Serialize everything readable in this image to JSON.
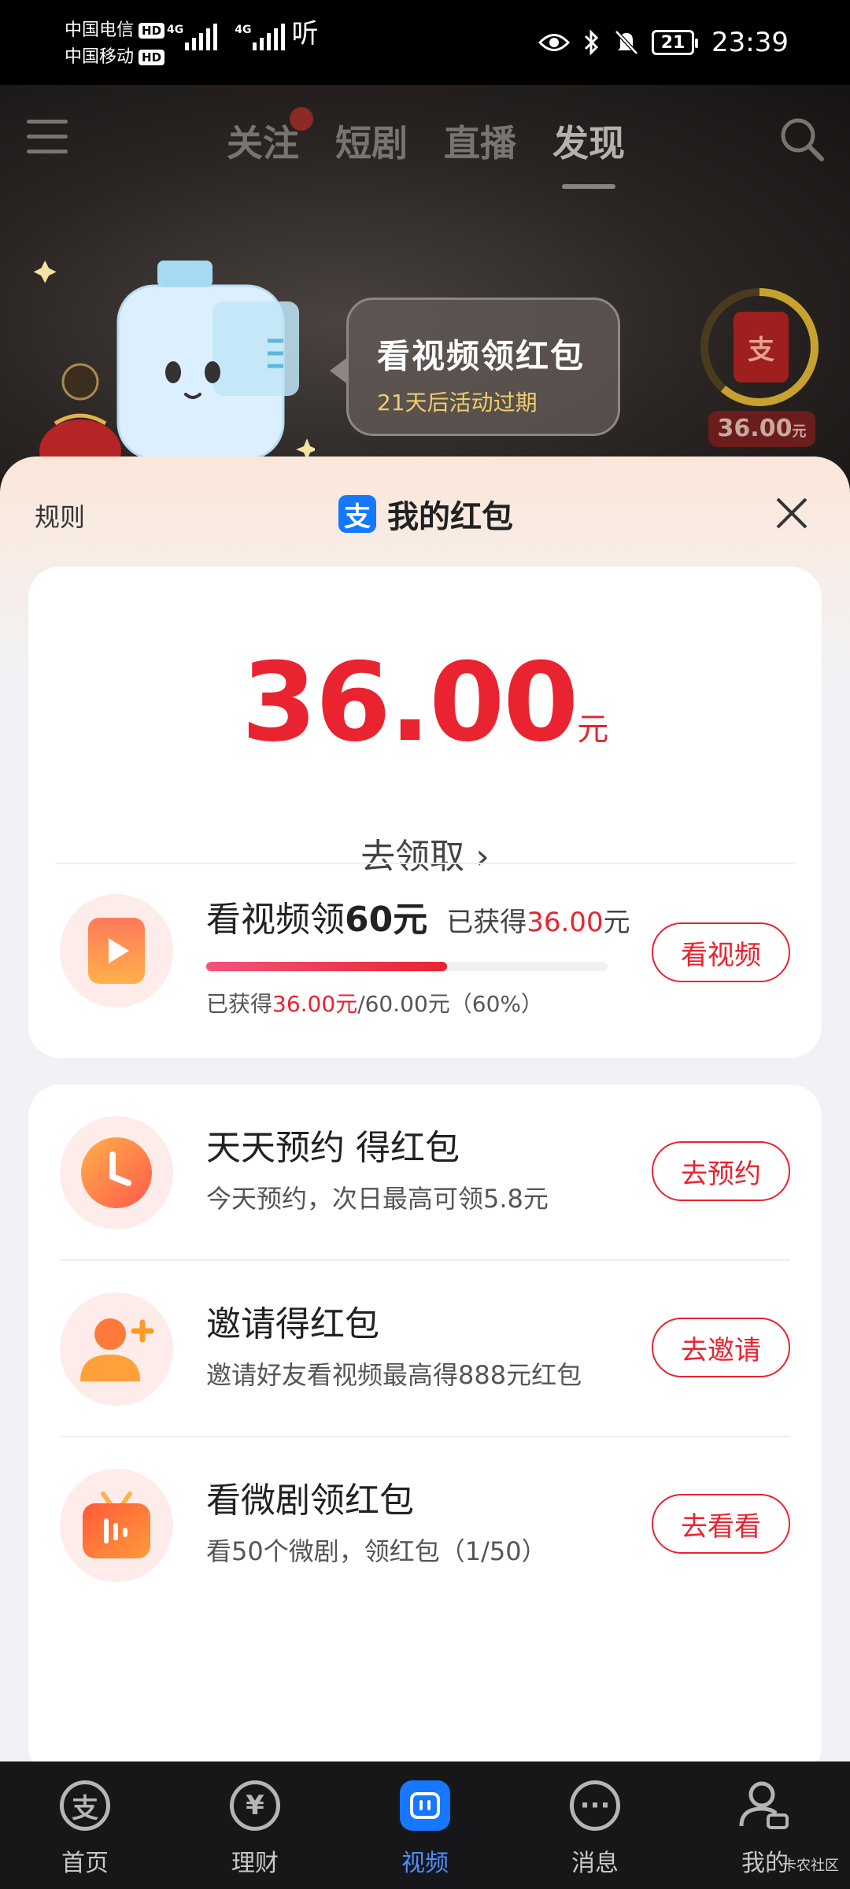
{
  "status_bar": {
    "carrier1": "中国电信",
    "carrier2": "中国移动",
    "hd": "HD",
    "net1": "4G",
    "net2": "4G",
    "hear_text": "听",
    "battery": "21",
    "time": "23:39"
  },
  "top_nav": {
    "tabs": [
      "关注",
      "短剧",
      "直播",
      "发现"
    ],
    "active_tab": "发现"
  },
  "promo": {
    "bubble_title": "看视频领红包",
    "bubble_subtitle": "21天后活动过期",
    "ring_amount": "36.00",
    "ring_unit": "元",
    "alipay_glyph": "支"
  },
  "sheet": {
    "rules": "规则",
    "title": "我的红包",
    "alipay_glyph": "支"
  },
  "balance": {
    "amount": "36.00",
    "unit": "元",
    "claim_label": "去领取",
    "claim_chevron": "›"
  },
  "video_task": {
    "title_prefix": "看视频领",
    "title_amount": "60元",
    "got_label": "已获得",
    "got_amount": "36.00",
    "got_unit": "元",
    "progress_got_label": "已获得",
    "progress_got": "36.00元",
    "progress_total": "/60.00元（60%）",
    "progress_fraction": 0.6,
    "button": "看视频"
  },
  "tasks": [
    {
      "title": "天天预约 得红包",
      "subtitle": "今天预约，次日最高可领5.8元",
      "button": "去预约",
      "icon": "clock-icon"
    },
    {
      "title": "邀请得红包",
      "subtitle": "邀请好友看视频最高得888元红包",
      "button": "去邀请",
      "icon": "add-user-icon"
    },
    {
      "title": "看微剧领红包",
      "subtitle": "看50个微剧，领红包（1/50）",
      "button": "去看看",
      "icon": "tv-icon"
    }
  ],
  "tab_bar": {
    "items": [
      {
        "label": "首页",
        "glyph": "支"
      },
      {
        "label": "理财",
        "glyph": "¥"
      },
      {
        "label": "视频",
        "glyph": ""
      },
      {
        "label": "消息",
        "glyph": "···"
      },
      {
        "label": "我的",
        "glyph": ""
      }
    ],
    "active": "视频"
  },
  "watermark": "卡农社区",
  "colors": {
    "accent_red": "#e9232f",
    "alipay_blue": "#1677ff",
    "promo_gold": "#f0cd6a"
  }
}
